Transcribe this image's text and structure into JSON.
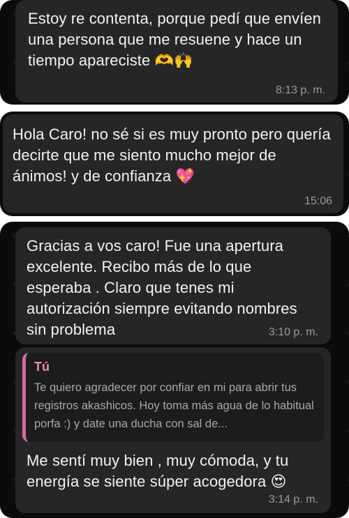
{
  "messages": [
    {
      "text": "Estoy re contenta, porque pedí que envíen una persona que me resuene y hace un tiempo apareciste",
      "emoji": "🫶🙌",
      "time": "8:13 p. m."
    },
    {
      "text": "Hola Caro! no sé si es muy pronto pero quería decirte que me siento mucho mejor de ánimos! y de confianza",
      "emoji": "💖",
      "time": "15:06"
    },
    {
      "text": "Gracias a vos caro! Fue una apertura excelente. Recibo más de lo que esperaba . Claro que tenes mi autorización siempre evitando nombres sin problema",
      "time": "3:10 p. m."
    },
    {
      "quote": {
        "author": "Tú",
        "text": "Te quiero agradecer por confiar en mi para abrir tus registros akashicos. Hoy toma más agua de lo habitual porfa :) y date una ducha con sal de..."
      },
      "text": "Me sentí muy bien , muy cómoda, y tu energía se siente súper acogedora",
      "emoji": "😍",
      "time": "3:14 p. m."
    }
  ]
}
